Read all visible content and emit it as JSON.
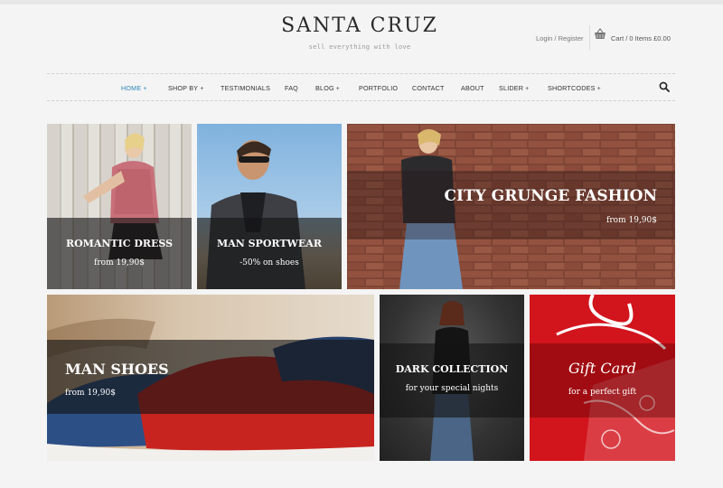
{
  "brand": {
    "name": "SANTA CRUZ",
    "tagline": "sell everything with love"
  },
  "header": {
    "account": "Login / Register",
    "cart": "Cart / 0 Items £0.00"
  },
  "nav": {
    "items": [
      {
        "label": "HOME",
        "has_sub": true,
        "active": true
      },
      {
        "label": "SHOP BY",
        "has_sub": true
      },
      {
        "label": "TESTIMONIALS",
        "has_sub": false
      },
      {
        "label": "FAQ",
        "has_sub": false
      },
      {
        "label": "BLOG",
        "has_sub": true
      },
      {
        "label": "PORTFOLIO",
        "has_sub": false
      },
      {
        "label": "CONTACT",
        "has_sub": false
      },
      {
        "label": "ABOUT",
        "has_sub": false
      },
      {
        "label": "SLIDER",
        "has_sub": true
      },
      {
        "label": "SHORTCODES",
        "has_sub": true
      }
    ],
    "plus": "+",
    "active_color": "#2e86b9"
  },
  "tiles": {
    "romantic": {
      "title": "ROMANTIC DRESS",
      "sub": "from 19,90$"
    },
    "sportwear": {
      "title": "MAN SPORTWEAR",
      "sub": "-50% on shoes"
    },
    "grunge": {
      "title": "CITY GRUNGE FASHION",
      "sub": "from 19,90$"
    },
    "shoes": {
      "title": "MAN SHOES",
      "sub": "from 19,90$"
    },
    "dark": {
      "title": "DARK COLLECTION",
      "sub": "for your special nights"
    },
    "gift": {
      "title": "Gift Card",
      "sub": "for a perfect gift"
    }
  }
}
